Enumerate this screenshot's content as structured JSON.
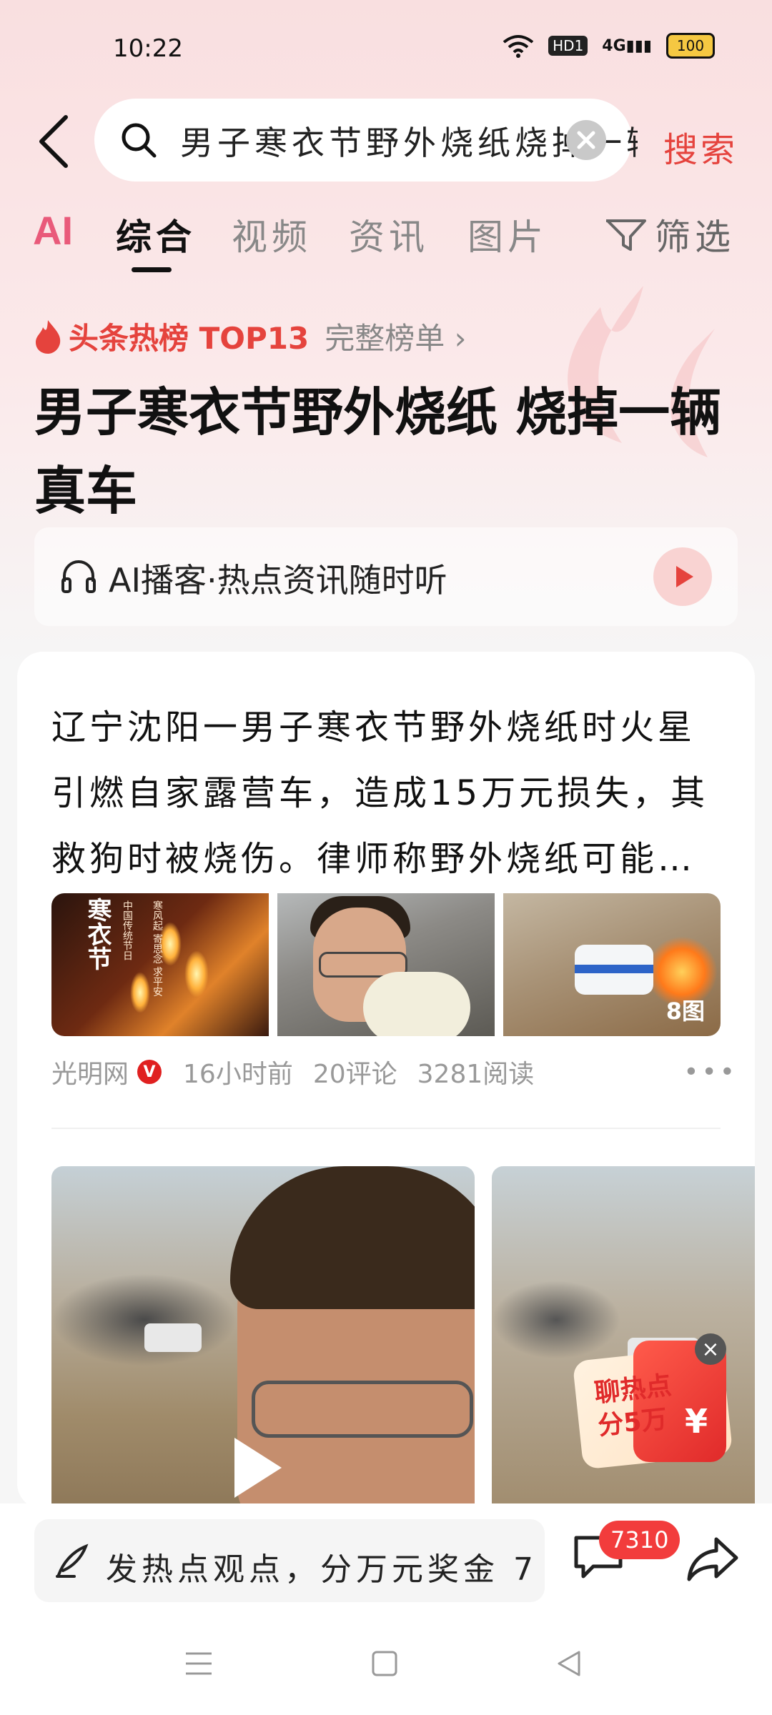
{
  "status_bar": {
    "time": "10:22",
    "network": "4G",
    "hd": "HD1",
    "battery": "100"
  },
  "search": {
    "query": "男子寒衣节野外烧纸烧掉一辆真车",
    "button_label": "搜索"
  },
  "tabs": {
    "ai_label": "AI",
    "items": [
      {
        "label": "综合",
        "active": true
      },
      {
        "label": "视频"
      },
      {
        "label": "资讯"
      },
      {
        "label": "图片"
      }
    ],
    "filter_label": "筛选"
  },
  "hot_list": {
    "label": "头条热榜 TOP13",
    "full_list_label": "完整榜单"
  },
  "headline": "男子寒衣节野外烧纸 烧掉一辆真车",
  "podcast": {
    "label": "AI播客·热点资讯随时听"
  },
  "article": {
    "summary": "辽宁沈阳一男子寒衣节野外烧纸时火星引燃自家露营车，造成15万元损失，其救狗时被烧伤。律师称野外烧纸可能面临处罚",
    "thumbnail_1_title": "寒衣节",
    "thumbnail_1_sub": "中国传统节日",
    "thumbnail_1_verse": "寒风起 寄思念 求平安",
    "image_count": "8图",
    "source": "光明网",
    "time": "16小时前",
    "comments": "20评论",
    "reads": "3281阅读"
  },
  "promo": {
    "text_line1": "聊热点",
    "text_line2": "分5万",
    "currency": "¥"
  },
  "bottom_bar": {
    "comment_placeholder": "发热点观点，分万元奖金 7.",
    "comment_badge": "7310"
  },
  "colors": {
    "accent": "#e5433d",
    "badge": "#f23c3c",
    "ai_tab": "#e95a7a"
  }
}
